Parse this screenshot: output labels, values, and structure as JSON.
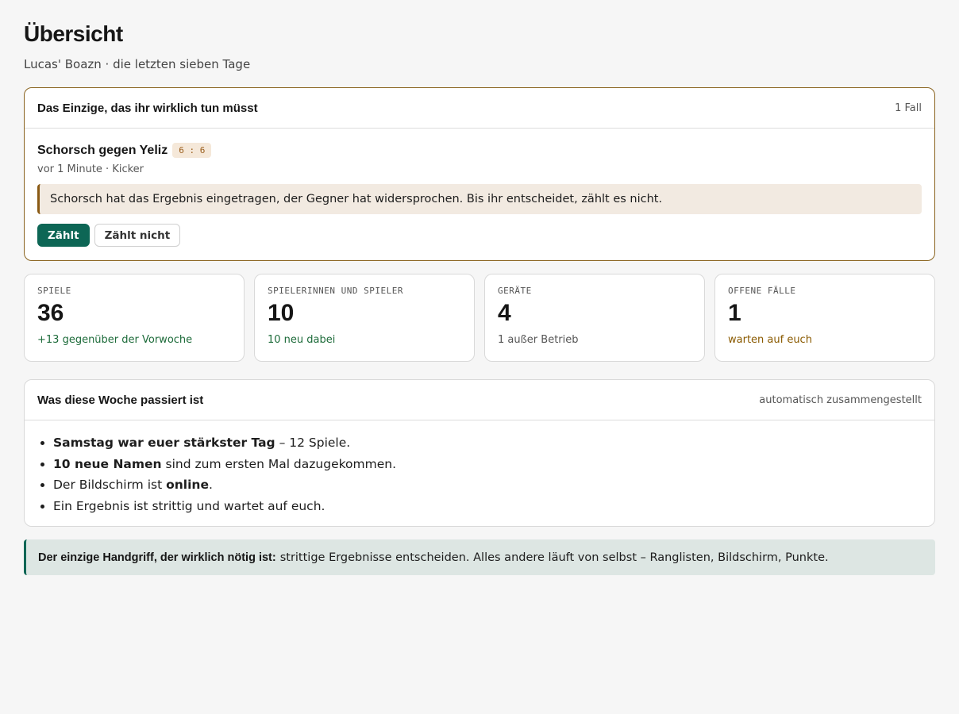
{
  "page": {
    "title": "Übersicht",
    "subtitle": "Lucas' Boazn · die letzten sieben Tage"
  },
  "case_card": {
    "title": "Das Einzige, das ihr wirklich tun müsst",
    "count": "1 Fall",
    "match": {
      "name": "Schorsch gegen Yeliz",
      "score": "6 : 6",
      "meta": "vor 1 Minute · Kicker",
      "note": "Schorsch hat das Ergebnis eingetragen, der Gegner hat widersprochen. Bis ihr entscheidet, zählt es nicht."
    },
    "actions": {
      "accept_label": "Zählt",
      "reject_label": "Zählt nicht"
    }
  },
  "stats": [
    {
      "label": "SPIELE",
      "value": "36",
      "note": "+13 gegenüber der Vorwoche",
      "tone": "green"
    },
    {
      "label": "SPIELERINNEN UND SPIELER",
      "value": "10",
      "note": "10 neu dabei",
      "tone": "green"
    },
    {
      "label": "GERÄTE",
      "value": "4",
      "note": "1 außer Betrieb",
      "tone": "grey"
    },
    {
      "label": "OFFENE FÄLLE",
      "value": "1",
      "note": "warten auf euch",
      "tone": "amber"
    }
  ],
  "week_card": {
    "title": "Was diese Woche passiert ist",
    "meta": "automatisch zusammengestellt",
    "items": [
      {
        "strong": "Samstag war euer stärkster Tag",
        "rest": " – 12 Spiele."
      },
      {
        "strong": "10 neue Namen",
        "rest": " sind zum ersten Mal dazugekommen."
      },
      {
        "pre": "Der Bildschirm ist ",
        "strong": "online",
        "rest": "."
      },
      {
        "pre": "Ein Ergebnis ist strittig und wartet auf euch."
      }
    ]
  },
  "hint": {
    "strong": "Der einzige Handgriff, der wirklich nötig ist:",
    "text": "strittige Ergebnisse entscheiden. Alles andere läuft von selbst – Ranglisten, Bildschirm, Punkte."
  },
  "colors": {
    "accent": "#0d6655",
    "case_border": "#8a6420",
    "positive": "#1d6b3a",
    "warning": "#8a5a00"
  }
}
